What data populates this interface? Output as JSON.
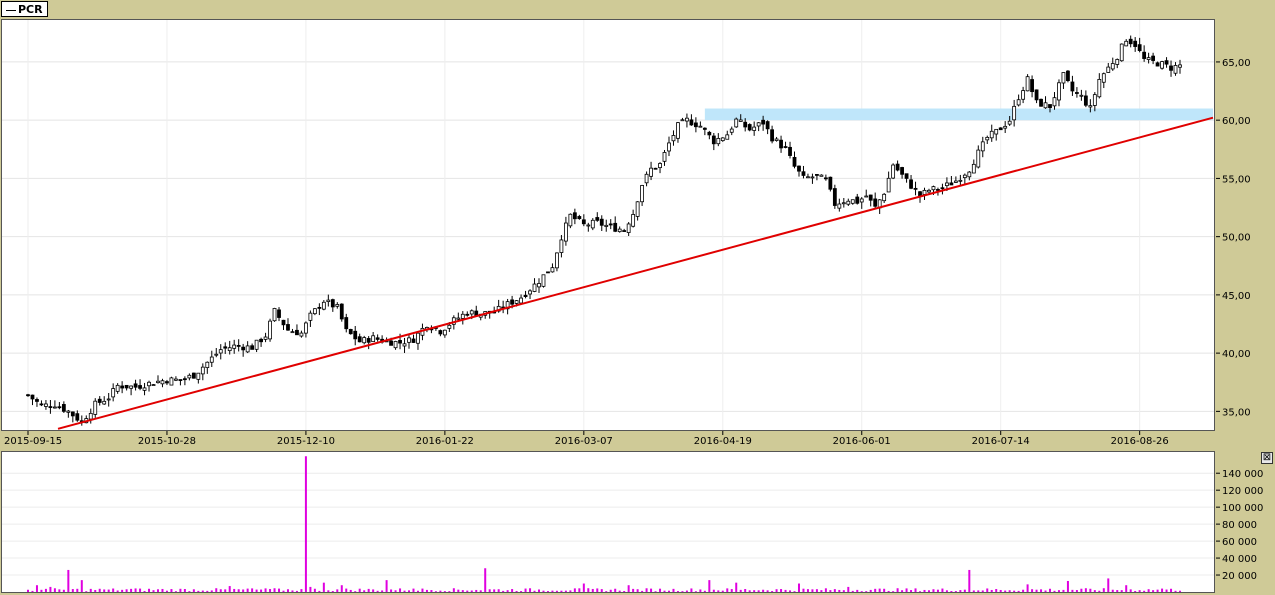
{
  "legend": {
    "ticker": "PCR"
  },
  "chart_data": [
    {
      "type": "candlestick",
      "series_name": "PCR",
      "y_ticks": [
        "65,00",
        "60,00",
        "55,00",
        "50,00",
        "45,00",
        "40,00",
        "35,00"
      ],
      "y_tick_values": [
        65,
        60,
        55,
        50,
        45,
        40,
        35
      ],
      "x_ticks": [
        "2015-09-15",
        "2015-10-28",
        "2015-12-10",
        "2016-01-22",
        "2016-03-07",
        "2016-04-19",
        "2016-06-01",
        "2016-07-14",
        "2016-08-26"
      ],
      "ylim": [
        33.4,
        68.6
      ],
      "grid": true,
      "close_path": [
        [
          0,
          36.4
        ],
        [
          3,
          35.5
        ],
        [
          6,
          35.6
        ],
        [
          9,
          35.0
        ],
        [
          12,
          34.1
        ],
        [
          15,
          35.6
        ],
        [
          18,
          36.2
        ],
        [
          20,
          37.2
        ],
        [
          24,
          37.1
        ],
        [
          28,
          37.5
        ],
        [
          31,
          37.7
        ],
        [
          34,
          37.7
        ],
        [
          37,
          38.1
        ],
        [
          40,
          39.2
        ],
        [
          43,
          40.3
        ],
        [
          46,
          40.6
        ],
        [
          50,
          40.5
        ],
        [
          53,
          41.5
        ],
        [
          55,
          43.6
        ],
        [
          58,
          42.0
        ],
        [
          61,
          41.7
        ],
        [
          63,
          43.2
        ],
        [
          66,
          44.5
        ],
        [
          69,
          43.9
        ],
        [
          71,
          41.9
        ],
        [
          74,
          41.0
        ],
        [
          77,
          41.3
        ],
        [
          80,
          41.0
        ],
        [
          83,
          40.9
        ],
        [
          86,
          41.2
        ],
        [
          89,
          42.5
        ],
        [
          92,
          41.9
        ],
        [
          95,
          42.8
        ],
        [
          98,
          43.5
        ],
        [
          101,
          43.4
        ],
        [
          104,
          43.5
        ],
        [
          107,
          44.2
        ],
        [
          110,
          44.8
        ],
        [
          112,
          45.5
        ],
        [
          114,
          46.2
        ],
        [
          117,
          47.5
        ],
        [
          119,
          50.0
        ],
        [
          121,
          51.8
        ],
        [
          124,
          51.0
        ],
        [
          127,
          51.2
        ],
        [
          130,
          50.8
        ],
        [
          133,
          50.6
        ],
        [
          135,
          52.0
        ],
        [
          137,
          54.5
        ],
        [
          139,
          55.8
        ],
        [
          141,
          56.2
        ],
        [
          143,
          58.0
        ],
        [
          145,
          59.5
        ],
        [
          147,
          60.0
        ],
        [
          150,
          59.5
        ],
        [
          153,
          58.2
        ],
        [
          156,
          58.8
        ],
        [
          158,
          60.0
        ],
        [
          161,
          59.2
        ],
        [
          164,
          59.8
        ],
        [
          166,
          58.5
        ],
        [
          169,
          57.5
        ],
        [
          171,
          56.0
        ],
        [
          173,
          55.0
        ],
        [
          176,
          55.2
        ],
        [
          178,
          54.8
        ],
        [
          180,
          52.8
        ],
        [
          183,
          53.2
        ],
        [
          185,
          53.0
        ],
        [
          187,
          53.5
        ],
        [
          189,
          52.5
        ],
        [
          191,
          53.8
        ],
        [
          193,
          56.2
        ],
        [
          196,
          54.8
        ],
        [
          199,
          53.5
        ],
        [
          201,
          54.0
        ],
        [
          204,
          54.2
        ],
        [
          207,
          54.8
        ],
        [
          210,
          55.8
        ],
        [
          212,
          57.2
        ],
        [
          214,
          58.5
        ],
        [
          216,
          59.0
        ],
        [
          219,
          60.0
        ],
        [
          221,
          62.0
        ],
        [
          223,
          63.5
        ],
        [
          225,
          61.5
        ],
        [
          228,
          61.2
        ],
        [
          231,
          63.8
        ],
        [
          233,
          62.5
        ],
        [
          235,
          62.0
        ],
        [
          237,
          61.0
        ],
        [
          239,
          63.5
        ],
        [
          241,
          64.5
        ],
        [
          243,
          65.5
        ],
        [
          245,
          67.0
        ],
        [
          247,
          66.5
        ],
        [
          249,
          65.2
        ],
        [
          251,
          65.0
        ],
        [
          253,
          64.8
        ],
        [
          255,
          64.5
        ],
        [
          257,
          64.7
        ]
      ],
      "bars": 258,
      "x_tick_bar_index": [
        0,
        31,
        62,
        93,
        124,
        155,
        186,
        217,
        248
      ]
    },
    {
      "type": "bar",
      "series_name": "Volume",
      "y_ticks": [
        "140 000",
        "120 000",
        "100 000",
        "80 000",
        "60 000",
        "40 000",
        "20 000"
      ],
      "y_tick_values": [
        140000,
        120000,
        100000,
        80000,
        60000,
        40000,
        20000
      ],
      "ylim": [
        0,
        165000
      ],
      "spikes": [
        [
          2,
          8000
        ],
        [
          5,
          6000
        ],
        [
          9,
          26000
        ],
        [
          12,
          14000
        ],
        [
          17,
          3000
        ],
        [
          25,
          4000
        ],
        [
          45,
          7000
        ],
        [
          49,
          4000
        ],
        [
          56,
          4000
        ],
        [
          62,
          160000
        ],
        [
          63,
          6000
        ],
        [
          66,
          11000
        ],
        [
          70,
          8000
        ],
        [
          80,
          14000
        ],
        [
          86,
          4000
        ],
        [
          102,
          28000
        ],
        [
          124,
          10000
        ],
        [
          134,
          8000
        ],
        [
          152,
          14000
        ],
        [
          158,
          11000
        ],
        [
          172,
          10000
        ],
        [
          183,
          6000
        ],
        [
          210,
          26000
        ],
        [
          223,
          9000
        ],
        [
          232,
          13000
        ],
        [
          241,
          16000
        ],
        [
          245,
          8000
        ],
        [
          253,
          4000
        ]
      ],
      "base_volume": 3000
    }
  ],
  "colors": {
    "frame": "#CFCA97",
    "trendline": "#E00000",
    "resistance_band": "#BFE6FA",
    "volume": "#E000E0",
    "candle": "#000000"
  },
  "trendline": {
    "from": [
      0,
      33.5
    ],
    "to": [
      270,
      60.8
    ]
  },
  "resistance_band": {
    "from_bar": 151,
    "to_bar": 270,
    "y_low": 60.0,
    "y_high": 61.0
  },
  "close_button_glyph": "⊠"
}
